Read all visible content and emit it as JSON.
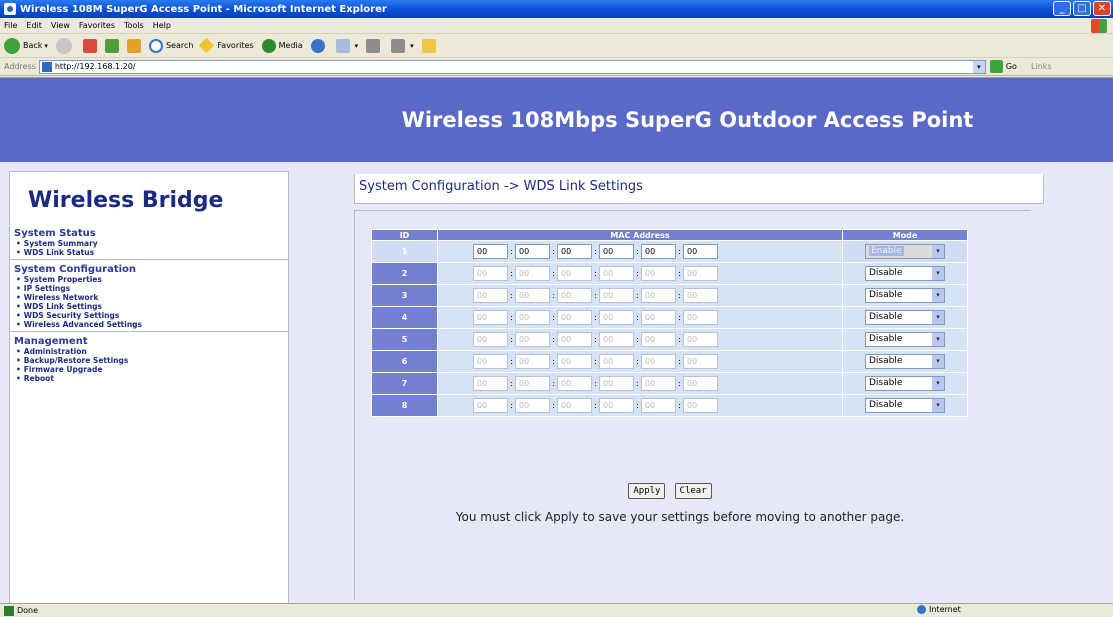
{
  "window": {
    "title": "Wireless 108M SuperG Access Point - Microsoft Internet Explorer",
    "controls": [
      "_",
      "□",
      "✕"
    ]
  },
  "menu": [
    "File",
    "Edit",
    "View",
    "Favorites",
    "Tools",
    "Help"
  ],
  "toolbar": {
    "back": "Back",
    "search": "Search",
    "favorites": "Favorites",
    "media": "Media"
  },
  "address": {
    "label": "Address",
    "url": "http://192.168.1.20/",
    "go": "Go",
    "links": "Links"
  },
  "page": {
    "banner": "Wireless 108Mbps SuperG Outdoor Access Point",
    "brand": "Wireless Bridge",
    "heading": "System Configuration -> WDS Link Settings",
    "nav": [
      {
        "head": "System Status",
        "items": [
          "System Summary",
          "WDS Link Status"
        ]
      },
      {
        "head": "System Configuration",
        "items": [
          "System Properties",
          "IP Settings",
          "Wireless Network",
          "WDS Link Settings",
          "WDS Security Settings",
          "Wireless Advanced Settings"
        ]
      },
      {
        "head": "Management",
        "items": [
          "Administration",
          "Backup/Restore Settings",
          "Firmware Upgrade",
          "Reboot"
        ]
      }
    ],
    "table": {
      "headers": {
        "id": "ID",
        "mac": "MAC Address",
        "mode": "Mode"
      },
      "rows": [
        {
          "id": "1",
          "mac": [
            "00",
            "00",
            "00",
            "00",
            "00",
            "00"
          ],
          "mode": "Enable"
        },
        {
          "id": "2",
          "mac": [
            "00",
            "00",
            "00",
            "00",
            "00",
            "00"
          ],
          "mode": "Disable"
        },
        {
          "id": "3",
          "mac": [
            "00",
            "00",
            "00",
            "00",
            "00",
            "00"
          ],
          "mode": "Disable"
        },
        {
          "id": "4",
          "mac": [
            "00",
            "00",
            "00",
            "00",
            "00",
            "00"
          ],
          "mode": "Disable"
        },
        {
          "id": "5",
          "mac": [
            "00",
            "00",
            "00",
            "00",
            "00",
            "00"
          ],
          "mode": "Disable"
        },
        {
          "id": "6",
          "mac": [
            "00",
            "00",
            "00",
            "00",
            "00",
            "00"
          ],
          "mode": "Disable"
        },
        {
          "id": "7",
          "mac": [
            "00",
            "00",
            "00",
            "00",
            "00",
            "00"
          ],
          "mode": "Disable"
        },
        {
          "id": "8",
          "mac": [
            "00",
            "00",
            "00",
            "00",
            "00",
            "00"
          ],
          "mode": "Disable"
        }
      ]
    },
    "buttons": {
      "apply": "Apply",
      "clear": "Clear"
    },
    "notice": "You must click Apply to save your settings before moving to another page."
  },
  "status": {
    "left": "Done",
    "zone": "Internet"
  }
}
